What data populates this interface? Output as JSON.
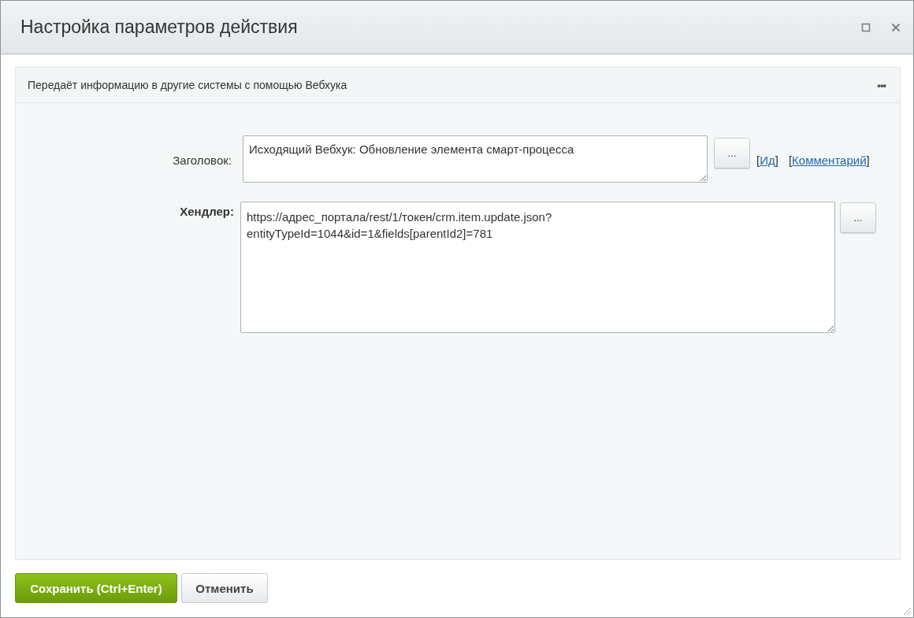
{
  "window": {
    "title": "Настройка параметров действия"
  },
  "panel": {
    "description": "Передаёт информацию в другие системы с помощью Вебхука",
    "menu_icon": "•••"
  },
  "fields": [
    {
      "kind": "title",
      "label": "Заголовок:",
      "required": false,
      "value": "Исходящий Вебхук: Обновление элемента смарт-процесса",
      "button": "...",
      "links": [
        {
          "open": "[",
          "label": "Ид",
          "close": "]"
        },
        {
          "open": "[",
          "label": "Комментарий",
          "close": "]"
        }
      ]
    },
    {
      "kind": "handler",
      "label": "Хендлер:",
      "required": true,
      "value": "https://адрес_портала/rest/1/токен/crm.item.update.json?\nentityTypeId=1044&id=1&fields[parentId2]=781",
      "button": "..."
    }
  ],
  "buttons": [
    {
      "label": "Сохранить (Ctrl+Enter)",
      "kind": "primary"
    },
    {
      "label": "Отменить",
      "kind": "secondary"
    }
  ]
}
